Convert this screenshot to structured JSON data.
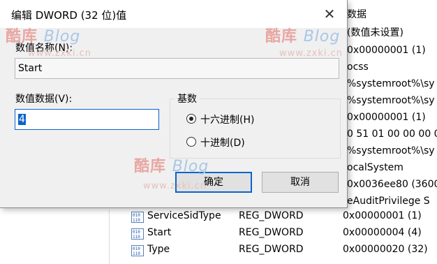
{
  "dialog": {
    "title": "编辑 DWORD (32 位)值",
    "close_glyph": "✕",
    "value_name_label": "数值名称(N):",
    "value_name": "Start",
    "value_data_label": "数值数据(V):",
    "value_data": "4",
    "base_group_label": "基数",
    "base_options": [
      {
        "label": "十六进制(H)",
        "checked": true
      },
      {
        "label": "十进制(D)",
        "checked": false
      }
    ],
    "ok_label": "确定",
    "cancel_label": "取消"
  },
  "registry": {
    "data_header": "数据",
    "partial_data": [
      "(数值未设置)",
      "0x00000001 (1)",
      "ocss",
      "%systemroot%\\sy",
      "%systemroot%\\sy",
      "0x00000001 (1)",
      "0 51 01 00 00 00 0",
      "%systemroot%\\sy",
      "ocalSystem",
      "0x0036ee80 (3600",
      "eAuditPrivilege S"
    ],
    "left_fragments": [
      "ic",
      "s"
    ],
    "rows": [
      {
        "name": "ServiceSidType",
        "type": "REG_DWORD",
        "data": "0x00000001 (1)"
      },
      {
        "name": "Start",
        "type": "REG_DWORD",
        "data": "0x00000004 (4)"
      },
      {
        "name": "Type",
        "type": "REG_DWORD",
        "data": "0x00000020 (32)"
      }
    ]
  },
  "watermark": {
    "logo_cn": "酷库",
    "logo_en": "Blog",
    "url": "www.zxki.cn"
  },
  "colors": {
    "accent": "#0a64c8",
    "dialog_bg": "#f0f0f0"
  }
}
